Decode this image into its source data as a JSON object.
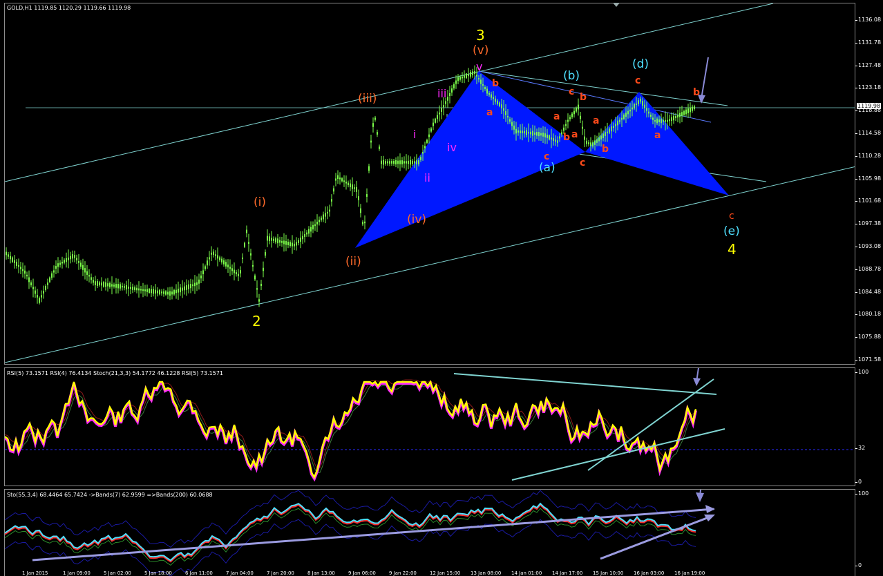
{
  "symbol_header": "GOLD,H1  1119.85 1120.29 1119.66 1119.98",
  "current_price": "1119.98",
  "price_axis": [
    "1136.08",
    "1131.78",
    "1127.48",
    "1123.18",
    "1118.88",
    "1114.58",
    "1110.28",
    "1105.98",
    "1101.68",
    "1097.38",
    "1093.08",
    "1088.78",
    "1084.48",
    "1080.18",
    "1075.88",
    "1071.58"
  ],
  "rsi_header": "RSI(5) 73.1571  RSI(4) 76.4134  Stoch(21,3,3) 54.1772 46.1228  RSI(5) 73.1571",
  "rsi_axis": [
    "100",
    "32",
    "0"
  ],
  "sto_header": "Sto(55,3,4) 68.4464 65.7424  ->Bands(7) 62.9599  =>Bands(200) 60.0688",
  "sto_axis": [
    "100",
    "0"
  ],
  "time_axis": [
    "1 Jan 2015",
    "1 Jan 09:00",
    "5 Jan 02:00",
    "5 Jan 18:00",
    "6 Jan 11:00",
    "7 Jan 04:00",
    "7 Jan 20:00",
    "8 Jan 13:00",
    "9 Jan 06:00",
    "9 Jan 22:00",
    "12 Jan 15:00",
    "13 Jan 08:00",
    "14 Jan 01:00",
    "14 Jan 17:00",
    "15 Jan 10:00",
    "16 Jan 03:00",
    "16 Jan 19:00"
  ],
  "waves": {
    "w2": "2",
    "w3": "3",
    "w4": "4",
    "ii_orange": "(ii)",
    "i_orange": "(i)",
    "iii_orange": "(iii)",
    "iv_orange": "(iv)",
    "v_orange": "(v)",
    "i_mag": "i",
    "ii_mag": "ii",
    "iii_mag": "iii",
    "iv_mag": "iv",
    "v_mag": "v",
    "a_cyan": "(a)",
    "b_cyan": "(b)",
    "d_cyan": "(d)",
    "e_cyan": "(e)",
    "b1": "b",
    "a1": "a",
    "a2": "a",
    "c1": "c",
    "b2": "b",
    "a3": "a",
    "c2": "c",
    "b3": "b",
    "c3": "c",
    "b4": "b",
    "a4": "a",
    "c4": "c",
    "a5": "a",
    "b5": "b",
    "c5": "c"
  },
  "colors": {
    "candles": "#7cff4a",
    "channel": "#7fd3d0",
    "harmonic": "#0018ff",
    "yellow": "#ffff00",
    "orange": "#ff6a2a",
    "magenta": "#ff2aff",
    "cyan": "#4fe0ff",
    "arrow": "#8a8ad6",
    "sto_trend": "#9b9be0"
  }
}
